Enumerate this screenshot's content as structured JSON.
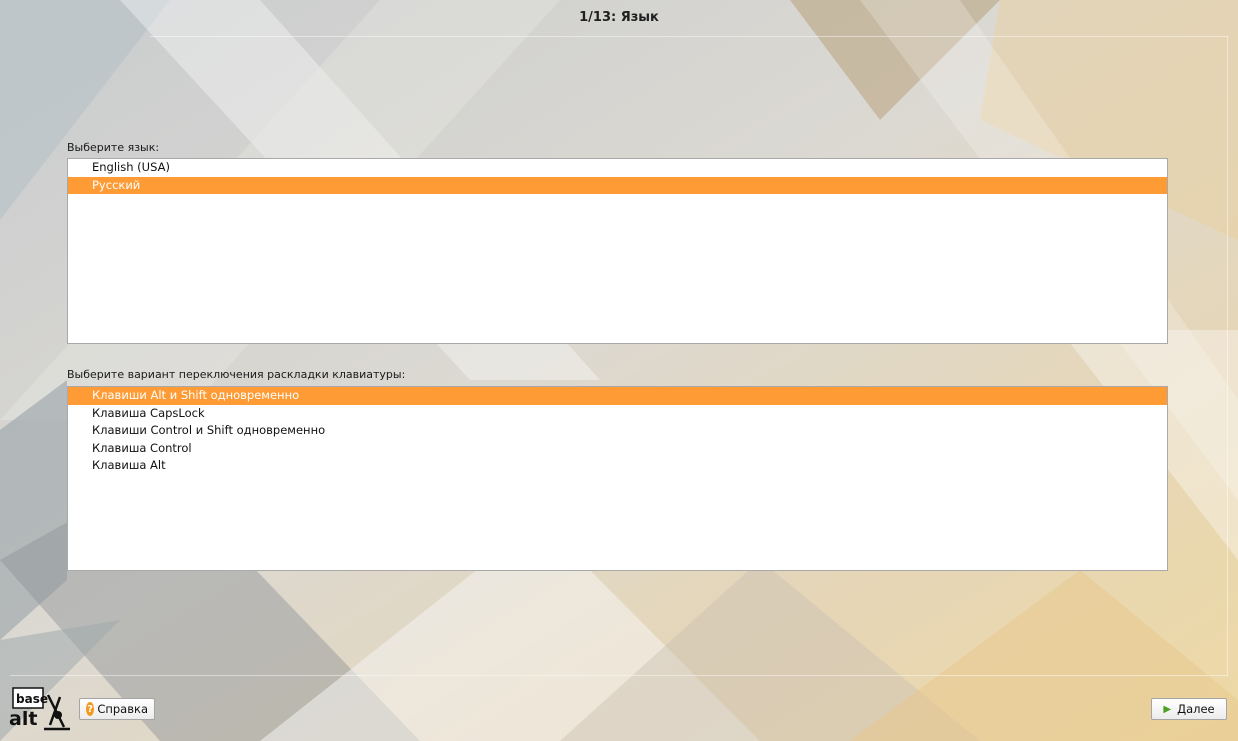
{
  "header": {
    "title": "1/13: Язык"
  },
  "language_section": {
    "label": "Выберите язык:",
    "items": [
      {
        "label": "English (USA)",
        "selected": false
      },
      {
        "label": "Русский",
        "selected": true
      }
    ]
  },
  "layout_section": {
    "label": "Выберите вариант переключения раскладки клавиатуры:",
    "items": [
      {
        "label": "Клавиши Alt и Shift одновременно",
        "selected": true
      },
      {
        "label": "Клавиша CapsLock",
        "selected": false
      },
      {
        "label": "Клавиши Control и Shift одновременно",
        "selected": false
      },
      {
        "label": "Клавиша Control",
        "selected": false
      },
      {
        "label": "Клавиша Alt",
        "selected": false
      }
    ]
  },
  "footer": {
    "logo_text_top": "base",
    "logo_text_bottom": "alt",
    "help_label": "Справка",
    "next_label": "Далее",
    "help_icon": "question-icon",
    "next_icon": "arrow-right-icon"
  },
  "colors": {
    "selection": "#ff9b35",
    "help_icon": "#f39a1e",
    "next_icon": "#4aa020"
  }
}
